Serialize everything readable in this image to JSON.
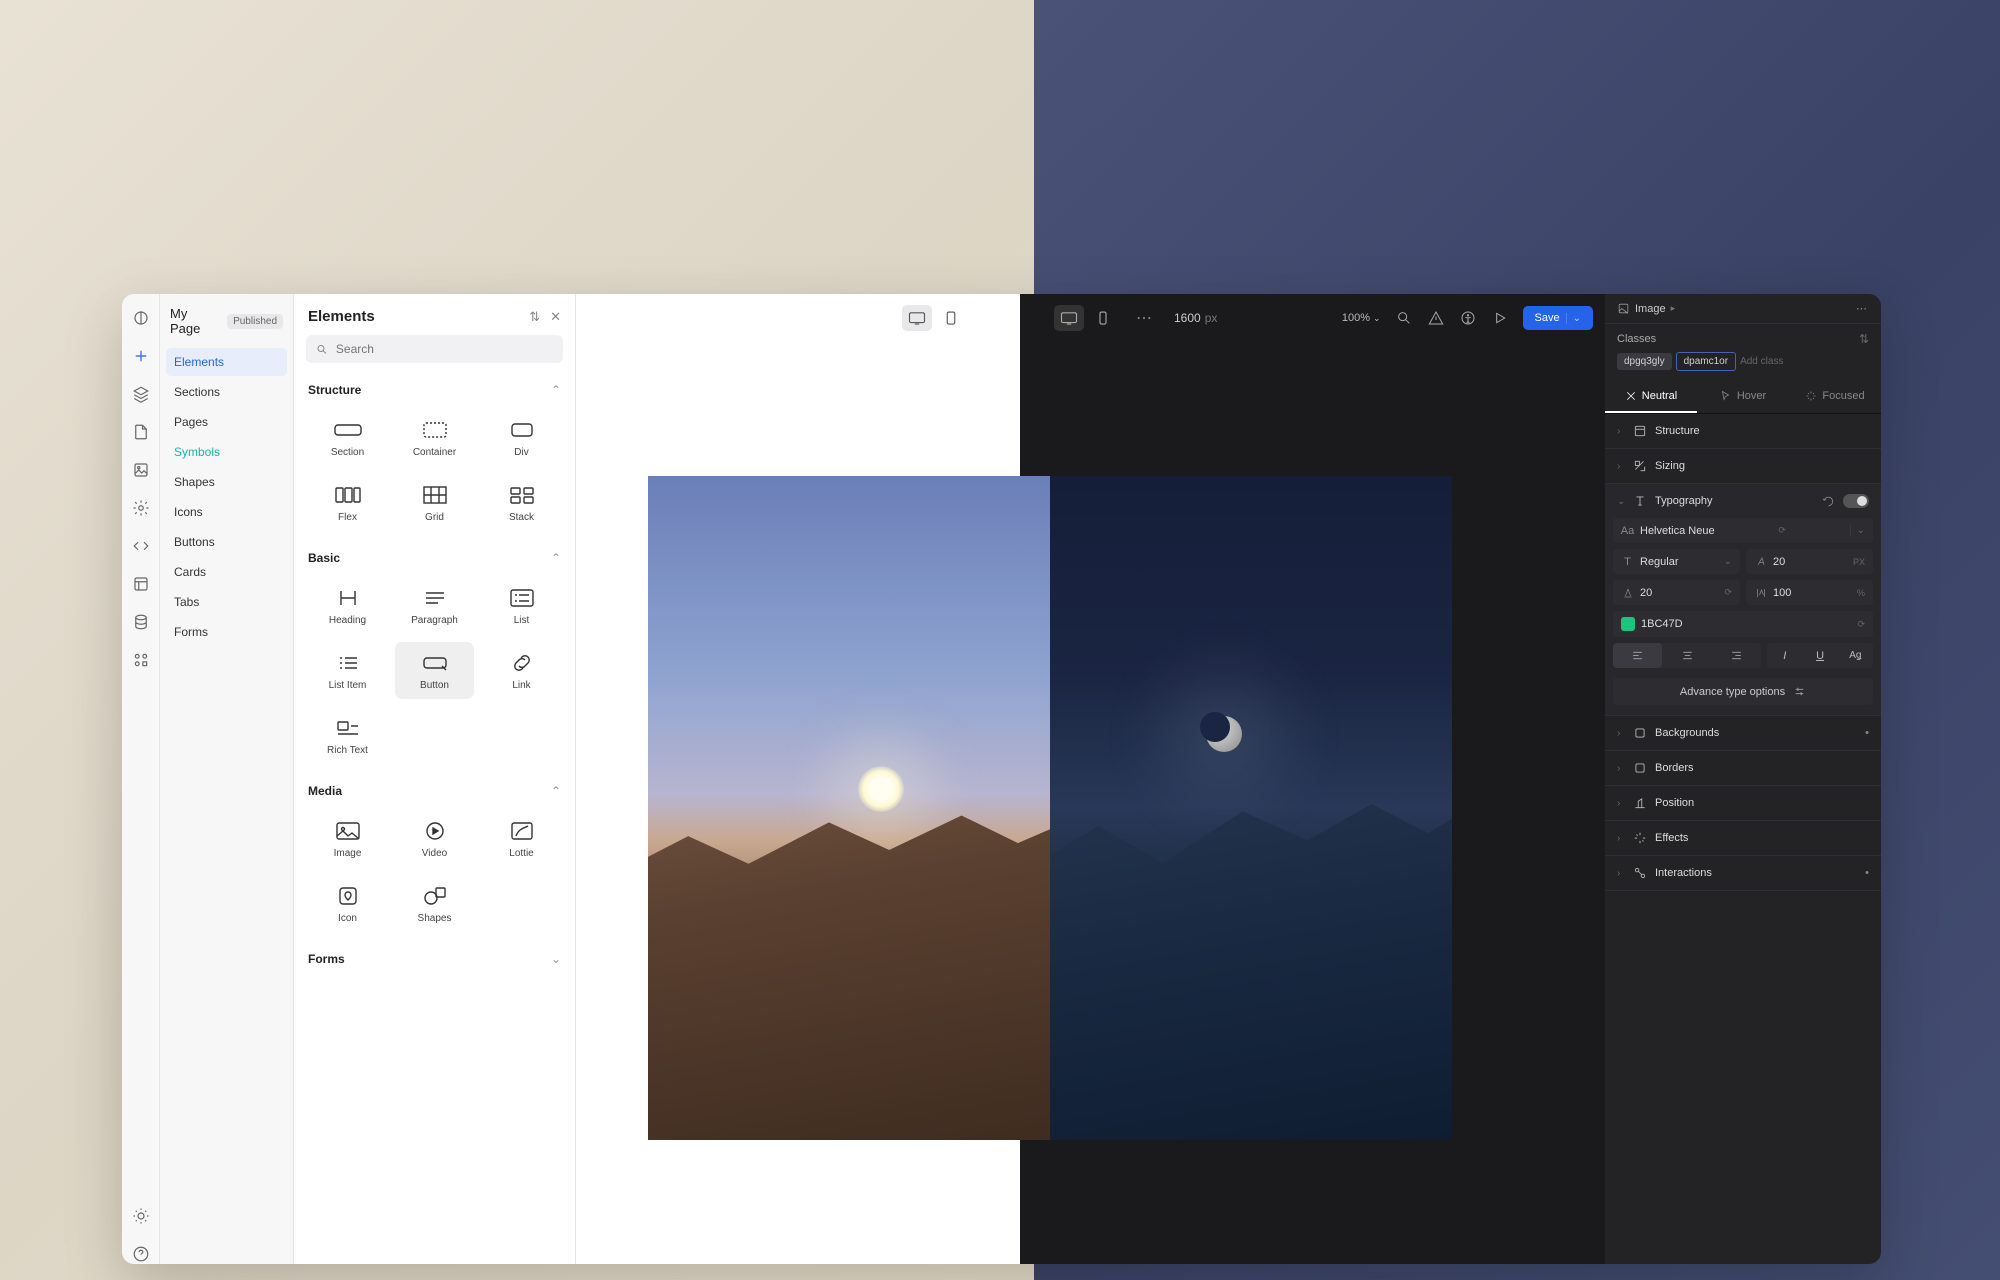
{
  "header": {
    "page_title": "My Page",
    "status_badge": "Published",
    "canvas_width": "1600",
    "canvas_unit": "px",
    "zoom": "100%",
    "save_label": "Save"
  },
  "nav": {
    "items": [
      "Elements",
      "Sections",
      "Pages",
      "Symbols",
      "Shapes",
      "Icons",
      "Buttons",
      "Cards",
      "Tabs",
      "Forms"
    ],
    "selected": "Elements",
    "teal": "Symbols"
  },
  "elements_panel": {
    "title": "Elements",
    "search_placeholder": "Search",
    "categories": [
      {
        "name": "Structure",
        "open": true,
        "items": [
          "Section",
          "Container",
          "Div",
          "Flex",
          "Grid",
          "Stack"
        ]
      },
      {
        "name": "Basic",
        "open": true,
        "items": [
          "Heading",
          "Paragraph",
          "List",
          "List Item",
          "Button",
          "Link",
          "Rich Text"
        ]
      },
      {
        "name": "Media",
        "open": true,
        "items": [
          "Image",
          "Video",
          "Lottie",
          "Icon",
          "Shapes"
        ]
      },
      {
        "name": "Forms",
        "open": false,
        "items": []
      }
    ],
    "hovered_tile": "Button"
  },
  "props": {
    "breadcrumb": "Image",
    "classes_label": "Classes",
    "classes": [
      "dpgq3gly",
      "dpamc1or"
    ],
    "add_class_placeholder": "Add class",
    "state_tabs": [
      "Neutral",
      "Hover",
      "Focused"
    ],
    "active_state": "Neutral",
    "sections": {
      "structure": "Structure",
      "sizing": "Sizing",
      "typography": "Typography",
      "backgrounds": "Backgrounds",
      "borders": "Borders",
      "position": "Position",
      "effects": "Effects",
      "interactions": "Interactions"
    },
    "typography": {
      "font_family": "Helvetica Neue",
      "weight": "Regular",
      "size": "20",
      "size_unit": "PX",
      "line_height": "20",
      "letter_spacing": "100",
      "letter_unit": "%",
      "color_hex": "1BC47D",
      "advance_btn": "Advance type options"
    }
  }
}
